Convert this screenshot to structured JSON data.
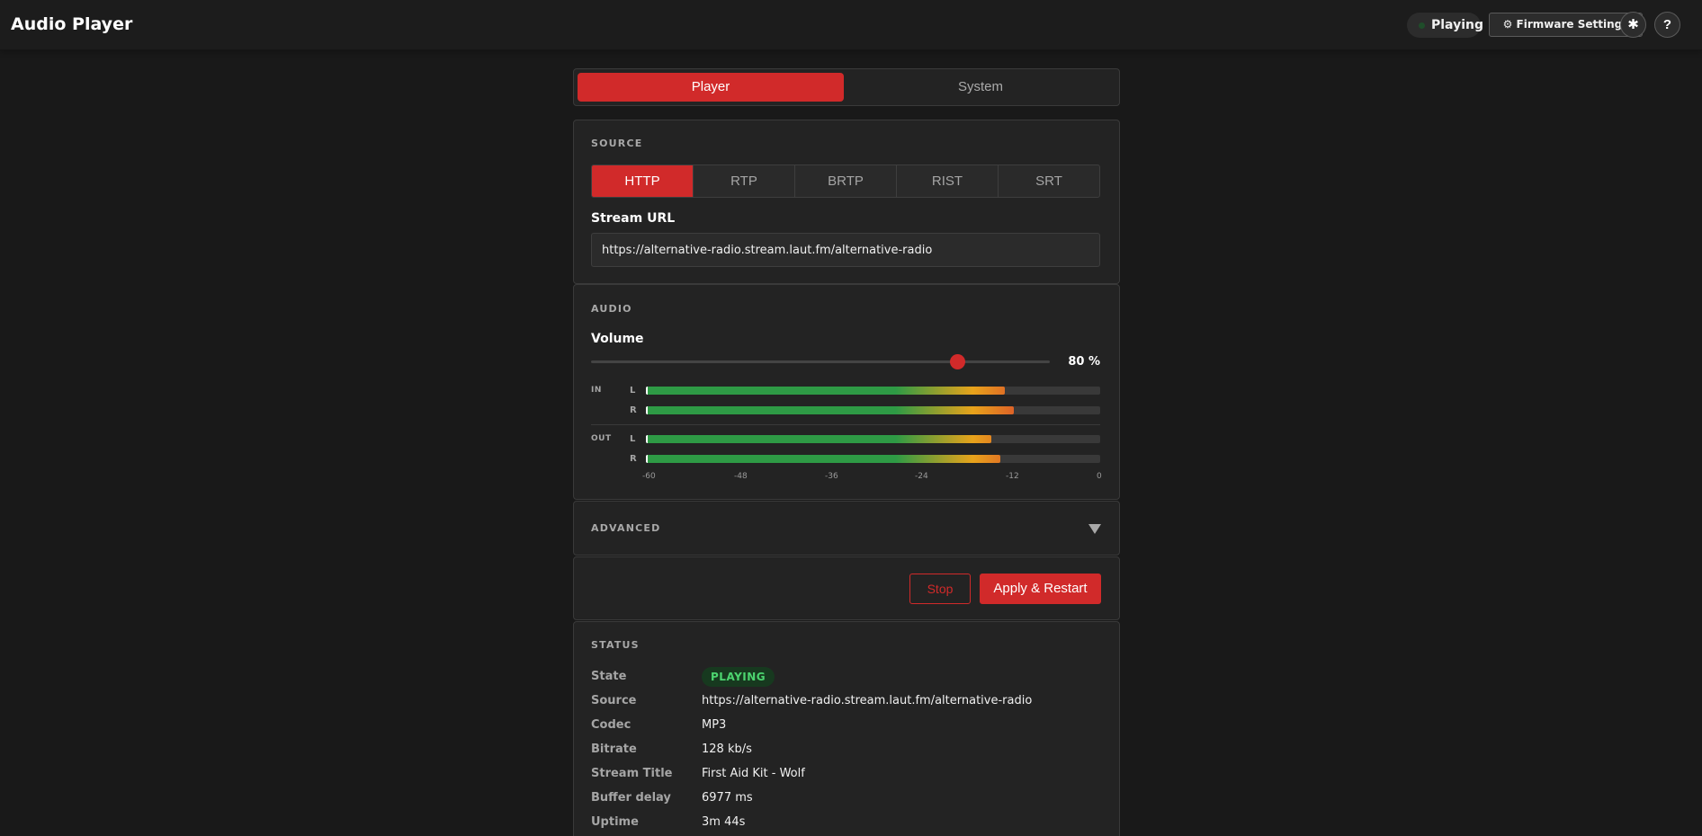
{
  "header": {
    "app_title": "Audio Player",
    "status_label": "Playing",
    "firmware_button": "⚙ Firmware Settings",
    "theme_icon": "✱",
    "help_label": "?"
  },
  "main_tabs": [
    "Player",
    "System"
  ],
  "source": {
    "section_label": "SOURCE",
    "protocols": [
      "HTTP",
      "RTP",
      "BRTP",
      "RIST",
      "SRT"
    ],
    "selected_protocol": "HTTP",
    "url_label": "Stream URL",
    "url_value": "https://alternative-radio.stream.laut.fm/alternative-radio"
  },
  "audio": {
    "section_label": "AUDIO",
    "volume_label": "Volume",
    "volume_percent": 80,
    "volume_text": "80 %",
    "in_label": "IN",
    "out_label": "OUT",
    "left_label": "L",
    "right_label": "R",
    "meters": {
      "in_l": 0.79,
      "in_r": 0.81,
      "out_l": 0.76,
      "out_r": 0.78
    },
    "scale": [
      "-60",
      "-48",
      "-36",
      "-24",
      "-12",
      "0"
    ]
  },
  "advanced": {
    "section_label": "ADVANCED"
  },
  "actions": {
    "stop_label": "Stop",
    "apply_label": "Apply & Restart"
  },
  "status": {
    "section_label": "STATUS",
    "rows": [
      {
        "key": "State",
        "value": "PLAYING"
      },
      {
        "key": "Source",
        "value": "https://alternative-radio.stream.laut.fm/alternative-radio"
      },
      {
        "key": "Codec",
        "value": "MP3"
      },
      {
        "key": "Bitrate",
        "value": "128 kb/s"
      },
      {
        "key": "Stream Title",
        "value": "First Aid Kit - Wolf"
      },
      {
        "key": "Buffer delay",
        "value": "6977 ms"
      },
      {
        "key": "Uptime",
        "value": "3m 44s"
      }
    ]
  },
  "colors": {
    "accent": "#d12a2a",
    "background": "#191919",
    "card": "#232323",
    "playing_green": "#4cd46f"
  }
}
